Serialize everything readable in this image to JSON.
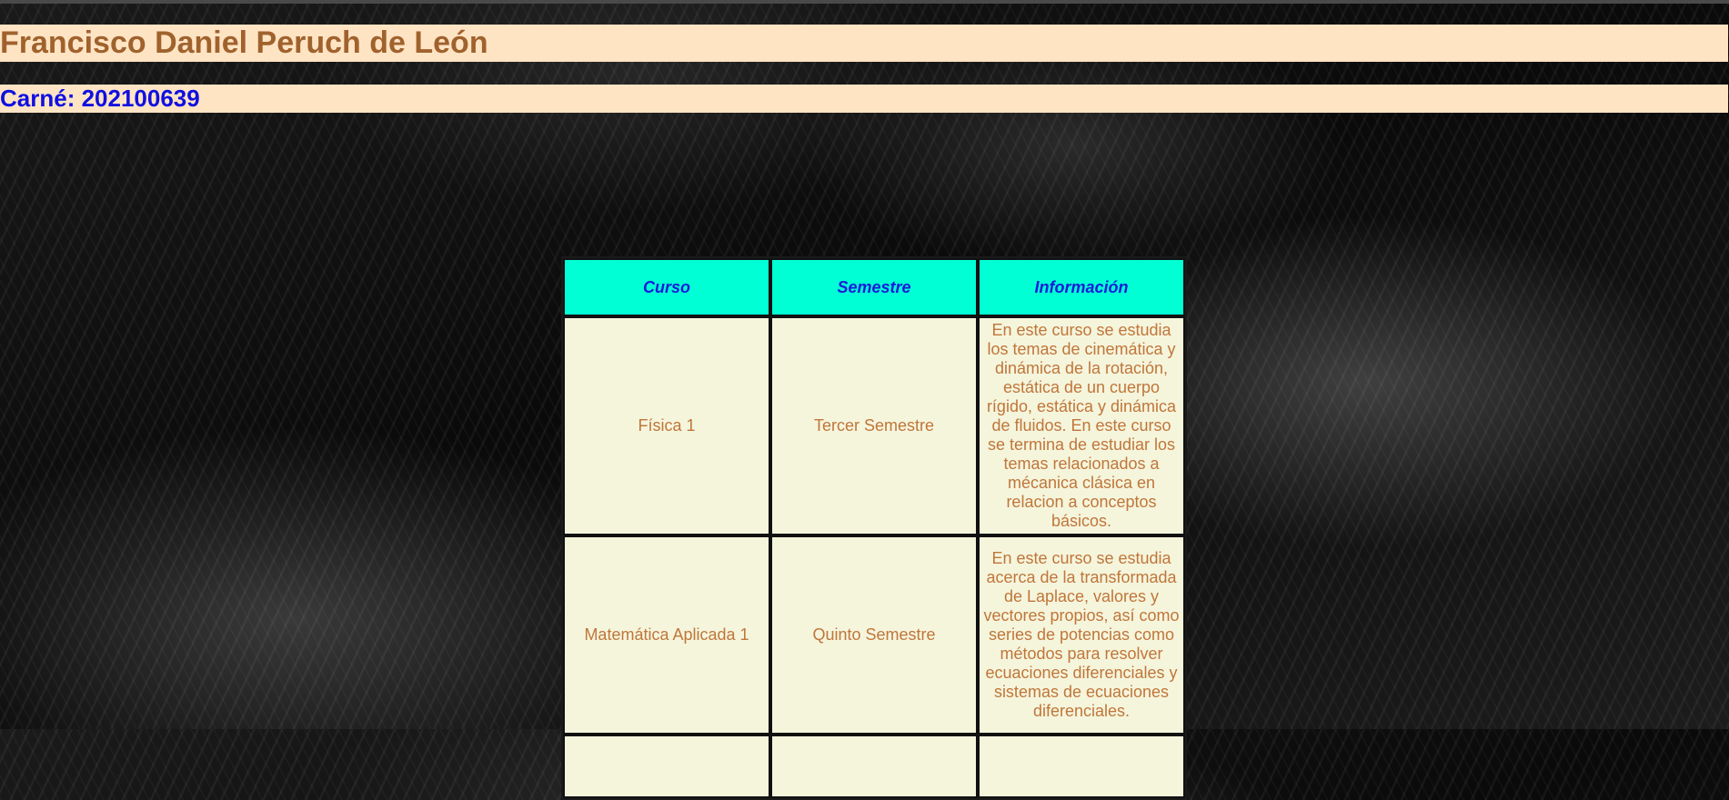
{
  "header": {
    "name": "Francisco Daniel Peruch de León",
    "carne": "Carné: 202100639"
  },
  "table": {
    "headers": [
      "Curso",
      "Semestre",
      "Información"
    ],
    "rows": [
      {
        "curso": "Física 1",
        "semestre": "Tercer Semestre",
        "info": "En este curso se estudia los temas de cinemática y dinámica de la rotación, estática de un cuerpo rígido, estática y dinámica de fluidos. En este curso se termina de estudiar los temas relacionados a mécanica clásica en relacion a conceptos básicos."
      },
      {
        "curso": "Matemática Aplicada 1",
        "semestre": "Quinto Semestre",
        "info": "En este curso se estudia acerca de la transformada de Laplace, valores y vectores propios, así como series de potencias como métodos para resolver ecuaciones diferenciales y sistemas de ecuaciones diferenciales."
      }
    ]
  },
  "colors": {
    "band_bg": "#ffe4c4",
    "name_text": "#a0622d",
    "carne_text": "#1010e0",
    "header_bg": "#00ffd5",
    "header_text": "#1a1ad8",
    "cell_bg": "#f5f5dc",
    "cell_text": "#c0763a"
  }
}
